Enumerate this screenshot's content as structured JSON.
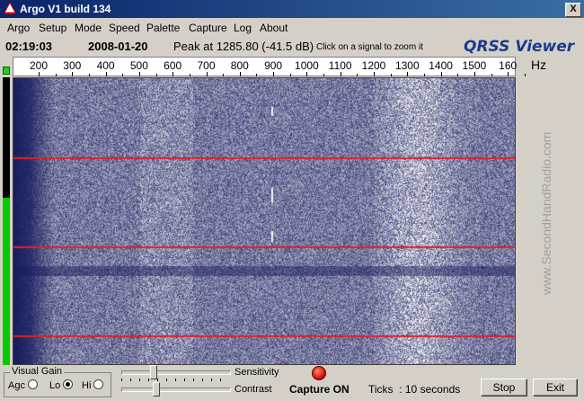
{
  "window": {
    "title": "Argo V1 build 134",
    "close_glyph": "X"
  },
  "menu": [
    {
      "label": "Argo"
    },
    {
      "label": "Setup"
    },
    {
      "label": "Mode"
    },
    {
      "label": "Speed"
    },
    {
      "label": "Palette"
    },
    {
      "label": "Capture"
    },
    {
      "label": "Log"
    },
    {
      "label": "About"
    }
  ],
  "status": {
    "time": "02:19:03",
    "date": "2008-01-20",
    "peak": "Peak at 1285.80 (-41.5 dB)",
    "hint": "Click on a signal to zoom it",
    "brand": "QRSS Viewer"
  },
  "scale": {
    "labels": [
      "200",
      "300",
      "400",
      "500",
      "600",
      "700",
      "800",
      "900",
      "1000",
      "1100",
      "1200",
      "1300",
      "1400",
      "1500",
      "160"
    ],
    "unit": "Hz"
  },
  "side_text": "www.SecondHandRadio.com",
  "level_fraction": 0.58,
  "controls": {
    "visual_gain_label": "Visual Gain",
    "agc": "Agc",
    "lo": "Lo",
    "hi": "Hi",
    "selected": "lo",
    "sensitivity_label": "Sensitivity",
    "contrast_label": "Contrast",
    "sensitivity_value": 0.28,
    "contrast_value": 0.31,
    "capture_text": "Capture ON",
    "ticks_text": "Ticks  : 10 seconds",
    "stop_label": "Stop",
    "exit_label": "Exit"
  },
  "colors": {
    "background": "#0f1550",
    "signal": "#ffffff",
    "marker": "#e0202a",
    "capture_led": "#d91010"
  }
}
